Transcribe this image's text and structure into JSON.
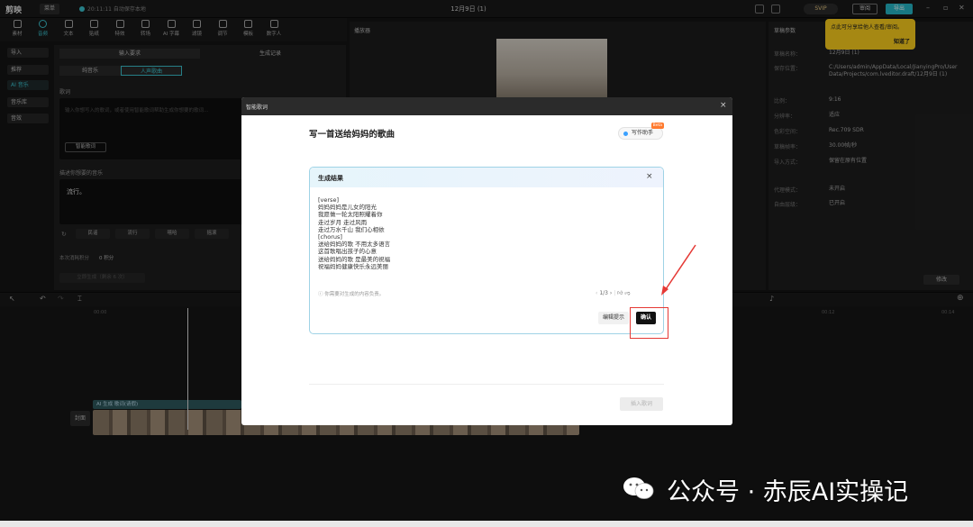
{
  "titlebar": {
    "logo": "剪映",
    "menu": "菜单",
    "autosave": "20:11:11 自动保存本地",
    "project_title": "12月9日 (1)",
    "svip": "SVIP",
    "share": "审阅",
    "export": "导出"
  },
  "tooltabs": [
    {
      "label": "素材",
      "active": false
    },
    {
      "label": "音频",
      "active": true
    },
    {
      "label": "文本",
      "active": false
    },
    {
      "label": "贴纸",
      "active": false
    },
    {
      "label": "特效",
      "active": false
    },
    {
      "label": "转场",
      "active": false
    },
    {
      "label": "AI 字幕",
      "active": false
    },
    {
      "label": "滤镜",
      "active": false
    },
    {
      "label": "调节",
      "active": false
    },
    {
      "label": "模板",
      "active": false
    },
    {
      "label": "数字人",
      "active": false
    }
  ],
  "sidebar": [
    {
      "label": "导入",
      "active": false
    },
    {
      "label": "推荐",
      "active": false
    },
    {
      "label": "AI 音乐",
      "active": true
    },
    {
      "label": "音乐库",
      "active": false
    },
    {
      "label": "音效",
      "active": false
    }
  ],
  "left_panel": {
    "tab_left": "输入要求",
    "tab_right": "生成记录",
    "sub_left": "纯音乐",
    "sub_right": "人声歌曲",
    "lyrics_label": "歌词",
    "lyrics_placeholder": "输入你想写入的歌词，或者使用智能歌词帮助生成你想要的歌词…",
    "smart_lyrics_btn": "智能歌词",
    "describe_label": "描述你想要的音乐",
    "describe_value": "流行。",
    "chips": [
      "民谣",
      "流行",
      "嘻哈",
      "摇滚"
    ],
    "cost_label": "本次消耗积分",
    "cost_value": "0 积分",
    "generate_btn": "立即生成（剩余 6 次）"
  },
  "player": {
    "title": "播放器",
    "ratio": "比例"
  },
  "right_panel": {
    "title": "草稿参数",
    "rows": [
      {
        "k": "草稿名称：",
        "v": "12月9日 (1)"
      },
      {
        "k": "保存位置：",
        "v": "C:/Users/admin/AppData/Local/JianyingPro/User Data/Projects/com.lveditor.draft/12月9日 (1)"
      },
      {
        "k": "比例：",
        "v": "9:16"
      },
      {
        "k": "分辨率：",
        "v": "适应"
      },
      {
        "k": "色彩空间：",
        "v": "Rec.709 SDR"
      },
      {
        "k": "草稿帧率：",
        "v": "30.00帧/秒"
      },
      {
        "k": "导入方式：",
        "v": "保留在原有位置"
      },
      {
        "k": "代理模式：",
        "v": "未开启"
      },
      {
        "k": "自由层级：",
        "v": "已开启"
      }
    ],
    "edit_btn": "修改"
  },
  "tooltip": {
    "text": "点此可分享给他人查看/审阅。",
    "ok": "知道了"
  },
  "timeline": {
    "cover": "封面",
    "audio_clip": "AI 生成  歌词(请假)",
    "times": [
      "00:00",
      "00:05",
      "00:10",
      "00:12",
      "00:14"
    ]
  },
  "modal": {
    "header": "智能歌词",
    "prompt": "写一首送给妈妈的歌曲",
    "assistant": "写作助手",
    "assistant_badge": "Beta",
    "result_title": "生成结果",
    "lyrics": [
      "[verse]",
      "妈妈妈妈是儿女的阳光",
      "我愿做一轮太阳照耀着你",
      "走过岁月 走过风雨",
      "走过万水千山 我们心相依",
      "[chorus]",
      "送给妈妈的歌 不用太多语言",
      "这首歌唱出孩子的心意",
      "送给妈妈的歌 是最美的祝福",
      "祝福妈妈健康快乐永远美丽"
    ],
    "disclaimer": "你需要对生成的内容负责。",
    "pager": "1/3",
    "edit_prompt": "编辑提示",
    "confirm": "确认",
    "insert": "插入歌词"
  },
  "watermark": "公众号 · 赤辰AI实操记"
}
